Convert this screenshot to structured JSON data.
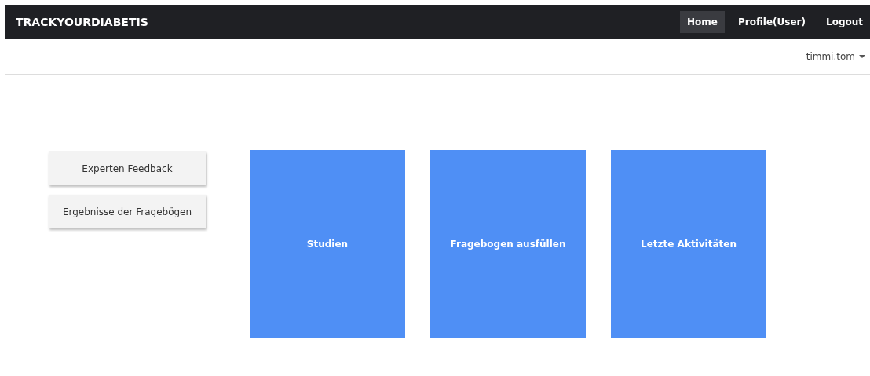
{
  "navbar": {
    "brand": "TRACKYOURDIABETIS",
    "items": [
      {
        "label": "Home",
        "selected": true
      },
      {
        "label": "Profile(User)",
        "selected": false
      },
      {
        "label": "Logout",
        "selected": false
      }
    ]
  },
  "user_menu": {
    "label": "timmi.tom"
  },
  "side_buttons": [
    "Experten Feedback",
    "Ergebnisse der Fragebögen"
  ],
  "tiles": [
    "Studien",
    "Fragebogen ausfüllen",
    "Letzte Aktivitäten"
  ]
}
